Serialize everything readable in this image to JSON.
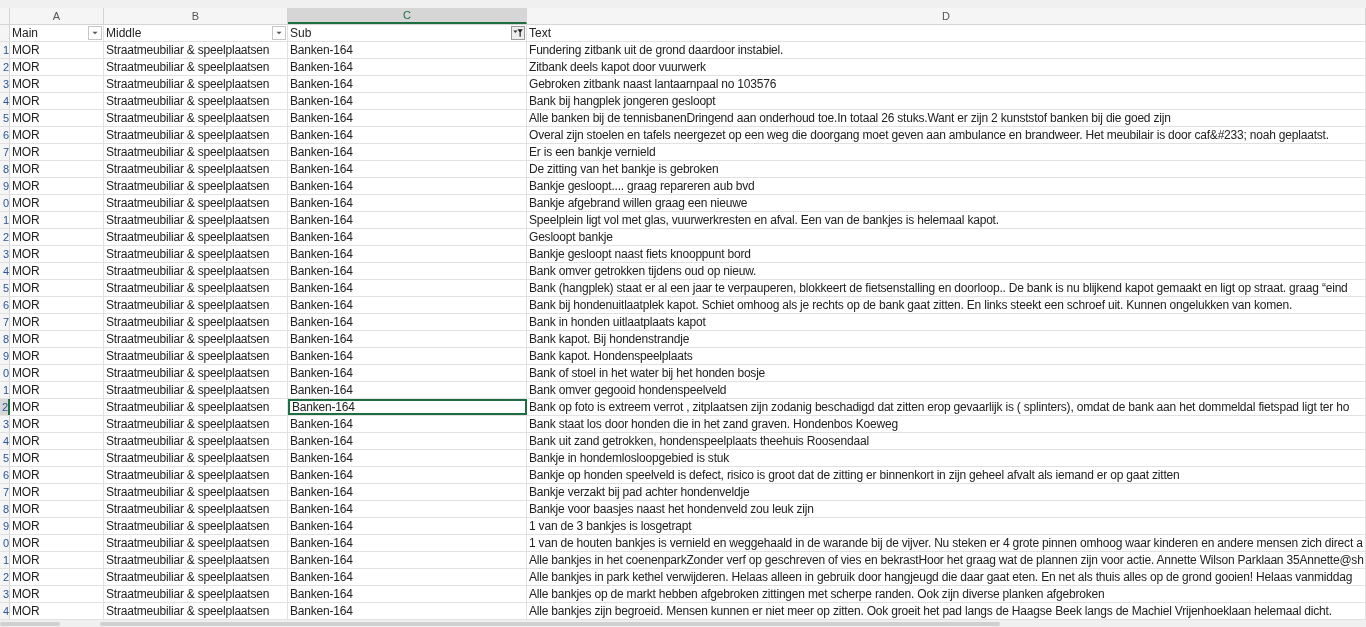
{
  "columns": [
    {
      "letter": "A",
      "selected": false
    },
    {
      "letter": "B",
      "selected": false
    },
    {
      "letter": "C",
      "selected": true
    },
    {
      "letter": "D",
      "selected": false
    }
  ],
  "header": [
    {
      "label": "Main",
      "filter_button": true,
      "filtered": false
    },
    {
      "label": "Middle",
      "filter_button": true,
      "filtered": false
    },
    {
      "label": "Sub",
      "filter_button": true,
      "filtered": true
    },
    {
      "label": "Text",
      "filter_button": false
    }
  ],
  "rows": [
    {
      "number": "1",
      "selected": false,
      "cells": [
        "MOR",
        "Straatmeubiliar & speelplaatsen",
        "Banken-164",
        "Fundering zitbank uit de grond daardoor instabiel."
      ]
    },
    {
      "number": "2",
      "selected": false,
      "cells": [
        "MOR",
        "Straatmeubiliar & speelplaatsen",
        "Banken-164",
        "Zitbank deels kapot door vuurwerk"
      ]
    },
    {
      "number": "3",
      "selected": false,
      "cells": [
        "MOR",
        "Straatmeubiliar & speelplaatsen",
        "Banken-164",
        "Gebroken zitbank naast lantaarnpaal no 103576"
      ]
    },
    {
      "number": "4",
      "selected": false,
      "cells": [
        "MOR",
        "Straatmeubiliar & speelplaatsen",
        "Banken-164",
        "Bank bij hangplek jongeren gesloopt"
      ]
    },
    {
      "number": "5",
      "selected": false,
      "cells": [
        "MOR",
        "Straatmeubiliar & speelplaatsen",
        "Banken-164",
        "Alle banken bij de tennisbanenDringend aan onderhoud toe.In totaal 26 stuks.Want er zijn 2 kunststof banken bij die goed zijn"
      ]
    },
    {
      "number": "6",
      "selected": false,
      "cells": [
        "MOR",
        "Straatmeubiliar & speelplaatsen",
        "Banken-164",
        "Overal zijn stoelen en tafels neergezet op een weg die doorgang moet geven aan ambulance en brandweer. Het meubilair is door caf&#233; noah geplaatst."
      ]
    },
    {
      "number": "7",
      "selected": false,
      "cells": [
        "MOR",
        "Straatmeubiliar & speelplaatsen",
        "Banken-164",
        "Er is een bankje vernield"
      ]
    },
    {
      "number": "8",
      "selected": false,
      "cells": [
        "MOR",
        "Straatmeubiliar & speelplaatsen",
        "Banken-164",
        "De zitting van het bankje is gebroken"
      ]
    },
    {
      "number": "9",
      "selected": false,
      "cells": [
        "MOR",
        "Straatmeubiliar & speelplaatsen",
        "Banken-164",
        "Bankje gesloopt.... graag repareren aub bvd"
      ]
    },
    {
      "number": "0",
      "selected": false,
      "cells": [
        "MOR",
        "Straatmeubiliar & speelplaatsen",
        "Banken-164",
        "Bankje afgebrand willen graag een nieuwe"
      ]
    },
    {
      "number": "1",
      "selected": false,
      "cells": [
        "MOR",
        "Straatmeubiliar & speelplaatsen",
        "Banken-164",
        "Speelplein ligt vol met glas, vuurwerkresten en afval. Een van de bankjes is helemaal kapot."
      ]
    },
    {
      "number": "2",
      "selected": false,
      "cells": [
        "MOR",
        "Straatmeubiliar & speelplaatsen",
        "Banken-164",
        "Gesloopt bankje"
      ]
    },
    {
      "number": "3",
      "selected": false,
      "cells": [
        "MOR",
        "Straatmeubiliar & speelplaatsen",
        "Banken-164",
        "Bankje gesloopt naast fiets knooppunt bord"
      ]
    },
    {
      "number": "4",
      "selected": false,
      "cells": [
        "MOR",
        "Straatmeubiliar & speelplaatsen",
        "Banken-164",
        "Bank omver getrokken tijdens oud op nieuw."
      ]
    },
    {
      "number": "5",
      "selected": false,
      "cells": [
        "MOR",
        "Straatmeubiliar & speelplaatsen",
        "Banken-164",
        "Bank (hangplek) staat er al een jaar te verpauperen, blokkeert de fietsenstalling en doorloop.. De bank is nu blijkend kapot gemaakt en ligt op straat. graag “eind"
      ]
    },
    {
      "number": "6",
      "selected": false,
      "cells": [
        "MOR",
        "Straatmeubiliar & speelplaatsen",
        "Banken-164",
        "Bank bij hondenuitlaatplek kapot. Schiet omhoog als je rechts op de bank gaat zitten. En links steekt een schroef uit. Kunnen ongelukken van komen."
      ]
    },
    {
      "number": "7",
      "selected": false,
      "cells": [
        "MOR",
        "Straatmeubiliar & speelplaatsen",
        "Banken-164",
        "Bank in honden uitlaatplaats kapot"
      ]
    },
    {
      "number": "8",
      "selected": false,
      "cells": [
        "MOR",
        "Straatmeubiliar & speelplaatsen",
        "Banken-164",
        "Bank kapot. Bij hondenstrandje"
      ]
    },
    {
      "number": "9",
      "selected": false,
      "cells": [
        "MOR",
        "Straatmeubiliar & speelplaatsen",
        "Banken-164",
        "Bank kapot. Hondenspeelplaats"
      ]
    },
    {
      "number": "0",
      "selected": false,
      "cells": [
        "MOR",
        "Straatmeubiliar & speelplaatsen",
        "Banken-164",
        "Bank of stoel in het water bij het honden bosje"
      ]
    },
    {
      "number": "1",
      "selected": false,
      "cells": [
        "MOR",
        "Straatmeubiliar & speelplaatsen",
        "Banken-164",
        "Bank omver gegooid hondenspeelveld"
      ]
    },
    {
      "number": "2",
      "selected": true,
      "cells": [
        "MOR",
        "Straatmeubiliar & speelplaatsen",
        "Banken-164",
        "Bank op foto is extreem verrot , zitplaatsen zijn zodanig beschadigd dat zitten erop gevaarlijk is ( splinters), omdat de bank aan het dommeldal fietspad ligt ter ho"
      ]
    },
    {
      "number": "3",
      "selected": false,
      "cells": [
        "MOR",
        "Straatmeubiliar & speelplaatsen",
        "Banken-164",
        "Bank staat los door honden die in het zand graven. Hondenbos Koeweg"
      ]
    },
    {
      "number": "4",
      "selected": false,
      "cells": [
        "MOR",
        "Straatmeubiliar & speelplaatsen",
        "Banken-164",
        "Bank uit zand getrokken, hondenspeelplaats theehuis Roosendaal"
      ]
    },
    {
      "number": "5",
      "selected": false,
      "cells": [
        "MOR",
        "Straatmeubiliar & speelplaatsen",
        "Banken-164",
        "Bankje in hondemlosloopgebied is stuk"
      ]
    },
    {
      "number": "6",
      "selected": false,
      "cells": [
        "MOR",
        "Straatmeubiliar & speelplaatsen",
        "Banken-164",
        "Bankje op honden speelveld is defect, risico is groot dat de zitting er binnenkort in zijn geheel afvalt als iemand er op gaat zitten"
      ]
    },
    {
      "number": "7",
      "selected": false,
      "cells": [
        "MOR",
        "Straatmeubiliar & speelplaatsen",
        "Banken-164",
        "Bankje verzakt bij pad achter hondenveldje"
      ]
    },
    {
      "number": "8",
      "selected": false,
      "cells": [
        "MOR",
        "Straatmeubiliar & speelplaatsen",
        "Banken-164",
        "Bankje voor baasjes naast het hondenveld zou leuk zijn"
      ]
    },
    {
      "number": "9",
      "selected": false,
      "cells": [
        "MOR",
        "Straatmeubiliar & speelplaatsen",
        "Banken-164",
        "1 van de 3 bankjes is losgetrapt"
      ]
    },
    {
      "number": "0",
      "selected": false,
      "cells": [
        "MOR",
        "Straatmeubiliar & speelplaatsen",
        "Banken-164",
        "1 van de houten bankjes is vernield en weggehaald in de warande bij de vijver. Nu steken er 4 grote pinnen omhoog waar kinderen en andere mensen zich direct a"
      ]
    },
    {
      "number": "1",
      "selected": false,
      "cells": [
        "MOR",
        "Straatmeubiliar & speelplaatsen",
        "Banken-164",
        "Alle bankjes in het coenenparkZonder verf op geschreven of vies en bekrastHoor het graag wat de plannen zijn voor actie. Annette Wilson Parklaan 35Annette@sh"
      ]
    },
    {
      "number": "2",
      "selected": false,
      "cells": [
        "MOR",
        "Straatmeubiliar & speelplaatsen",
        "Banken-164",
        "Alle bankjes in park kethel verwijderen. Helaas alleen in gebruik door hangjeugd die daar gaat eten. En net als thuis alles op de grond gooien! Helaas vanmiddag"
      ]
    },
    {
      "number": "3",
      "selected": false,
      "cells": [
        "MOR",
        "Straatmeubiliar & speelplaatsen",
        "Banken-164",
        "Alle bankjes op de markt hebben afgebroken zittingen met scherpe randen. Ook zijn diverse planken afgebroken"
      ]
    },
    {
      "number": "4",
      "selected": false,
      "cells": [
        "MOR",
        "Straatmeubiliar & speelplaatsen",
        "Banken-164",
        "Alle bankjes zijn begroeid. Mensen kunnen er niet meer op zitten. Ook groeit het pad langs de Haagse Beek langs de Machiel Vrijenhoeklaan helemaal dicht."
      ]
    }
  ]
}
